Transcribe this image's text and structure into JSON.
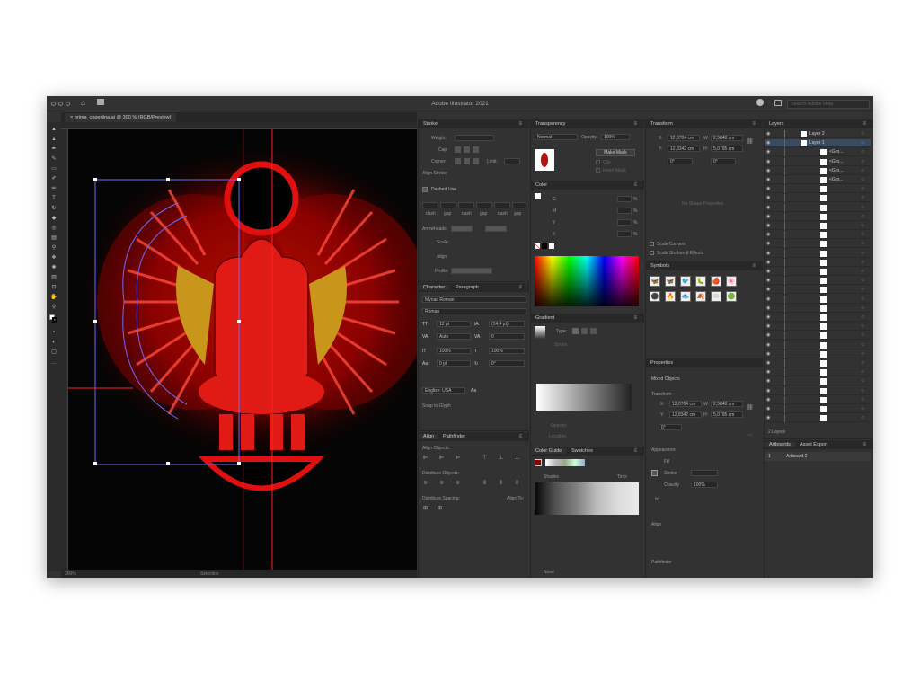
{
  "app": {
    "title": "Adobe Illustrator 2021",
    "search_placeholder": "Search Adobe Help"
  },
  "document": {
    "tab": "prima_copertina.ai @ 300 % (RGB/Preview)",
    "zoom": "300%",
    "tool_status": "Selection"
  },
  "stroke": {
    "title": "Stroke",
    "weight_label": "Weight:",
    "cap_label": "Cap:",
    "corner_label": "Corner:",
    "limit_label": "Limit:",
    "align_label": "Align Stroke:",
    "dashed_label": "Dashed Line",
    "dash_labels": [
      "dash",
      "gap",
      "dash",
      "gap",
      "dash",
      "gap"
    ],
    "arrowheads_label": "Arrowheads:",
    "scale_label": "Scale:",
    "align2_label": "Align:",
    "profile_label": "Profile:"
  },
  "transparency": {
    "title": "Transparency",
    "mode": "Normal",
    "opacity_label": "Opacity:",
    "opacity": "100%",
    "make_mask": "Make Mask",
    "clip": "Clip",
    "invert": "Invert Mask"
  },
  "color": {
    "title": "Color",
    "channels": [
      "C",
      "M",
      "Y",
      "K"
    ],
    "percent": "%"
  },
  "gradient": {
    "title": "Gradient",
    "type_label": "Type:",
    "stroke_label": "Stroke:",
    "opacity_label": "Opacity:",
    "location_label": "Location:"
  },
  "color_guide": {
    "tabs": [
      "Color Guide",
      "Swatches"
    ],
    "shades": "Shades",
    "tints": "Tints",
    "none": "None"
  },
  "character": {
    "tabs": [
      "Character",
      "Paragraph"
    ],
    "font": "Myriad Roman",
    "style": "Roman",
    "size": "12 pt",
    "leading": "(14,4 pt)",
    "kerning": "Auto",
    "tracking": "0",
    "vscale": "100%",
    "hscale": "100%",
    "baseline": "0 pt",
    "rotation": "0°",
    "language": "English: USA",
    "aa": "Aa",
    "snap": "Snap to Glyph"
  },
  "align": {
    "tabs": [
      "Align",
      "Pathfinder"
    ],
    "align_objects": "Align Objects:",
    "distribute_objects": "Distribute Objects:",
    "distribute_spacing": "Distribute Spacing:",
    "align_to": "Align To:"
  },
  "transform": {
    "title": "Transform",
    "x": "12,0704 cm",
    "y": "12,8342 cm",
    "w": "2,5848 cm",
    "h": "5,0795 cm",
    "angle": "0°",
    "shear": "0°",
    "no_shape": "No Shape Properties",
    "scale_corners": "Scale Corners",
    "scale_strokes": "Scale Strokes & Effects"
  },
  "symbols": {
    "title": "Symbols",
    "icons": [
      "🦋",
      "🦋",
      "🐦",
      "🐛",
      "🍎",
      "🌸",
      "⚫",
      "🔥",
      "🐟",
      "🍂",
      "✉",
      "🟢"
    ]
  },
  "properties": {
    "title": "Properties",
    "mixed": "Mixed Objects",
    "transform_label": "Transform",
    "x_label": "X:",
    "y_label": "Y:",
    "w_label": "W:",
    "h_label": "H:",
    "x": "12,0704 cm",
    "y": "12,8342 cm",
    "w": "2,5848 cm",
    "h": "5,0795 cm",
    "angle": "0°",
    "appearance": "Appearance",
    "fill": "Fill",
    "stroke": "Stroke",
    "opacity_label": "Opacity",
    "opacity": "100%",
    "align": "Align",
    "pathfinder": "Pathfinder",
    "fx": "fx."
  },
  "layers": {
    "title": "Layers",
    "count": "2 Layers",
    "rows": [
      "Layer 2",
      "Layer 1",
      "<Gro...",
      "<Gro...",
      "<Gro...",
      "<Gro..."
    ]
  },
  "artboards": {
    "tabs": [
      "Artboards",
      "Asset Export"
    ],
    "number": "1",
    "name": "Artboard 2"
  }
}
